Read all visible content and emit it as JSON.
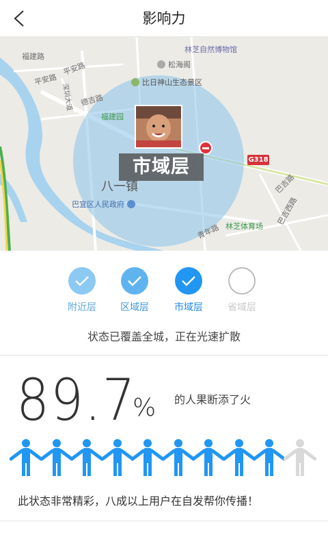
{
  "header": {
    "title": "影响力"
  },
  "map": {
    "labels": {
      "fujianlu": "福建路",
      "pinganlu": "平安路",
      "pinganlu2": "平安路",
      "shenzhen": "深圳大道",
      "dejilu": "德吉路",
      "bajiaolu": "巴吉路",
      "baijilu2": "巴吉西路",
      "qingnianlu": "青年路",
      "bayi": "八一镇"
    },
    "pois": {
      "museum": "林芝自然博物馆",
      "songhai": "松海阁",
      "bidi": "比日神山生态景区",
      "fujianyuan": "福建园",
      "gov": "巴宜区人民政府",
      "stadium": "林芝体育场"
    },
    "road_sign": "G318",
    "level_tag": "市域层"
  },
  "levels": [
    {
      "label": "附近层",
      "state": "done-light"
    },
    {
      "label": "区域层",
      "state": "done-mid"
    },
    {
      "label": "市域层",
      "state": "current"
    },
    {
      "label": "省域层",
      "state": "pending"
    }
  ],
  "status_text": "状态已覆盖全城，正在光速扩散",
  "stats": {
    "number": "89.7",
    "unit": "%",
    "description": "的人果断添了火",
    "filled_people": 9,
    "total_people": 10
  },
  "footer_text": "此状态非常精彩，八成以上用户在自发帮你传播！",
  "colors": {
    "accent": "#2196f3",
    "light": "#8cc9f3",
    "mid": "#5fb3ef",
    "gray": "#d9d9d9"
  }
}
